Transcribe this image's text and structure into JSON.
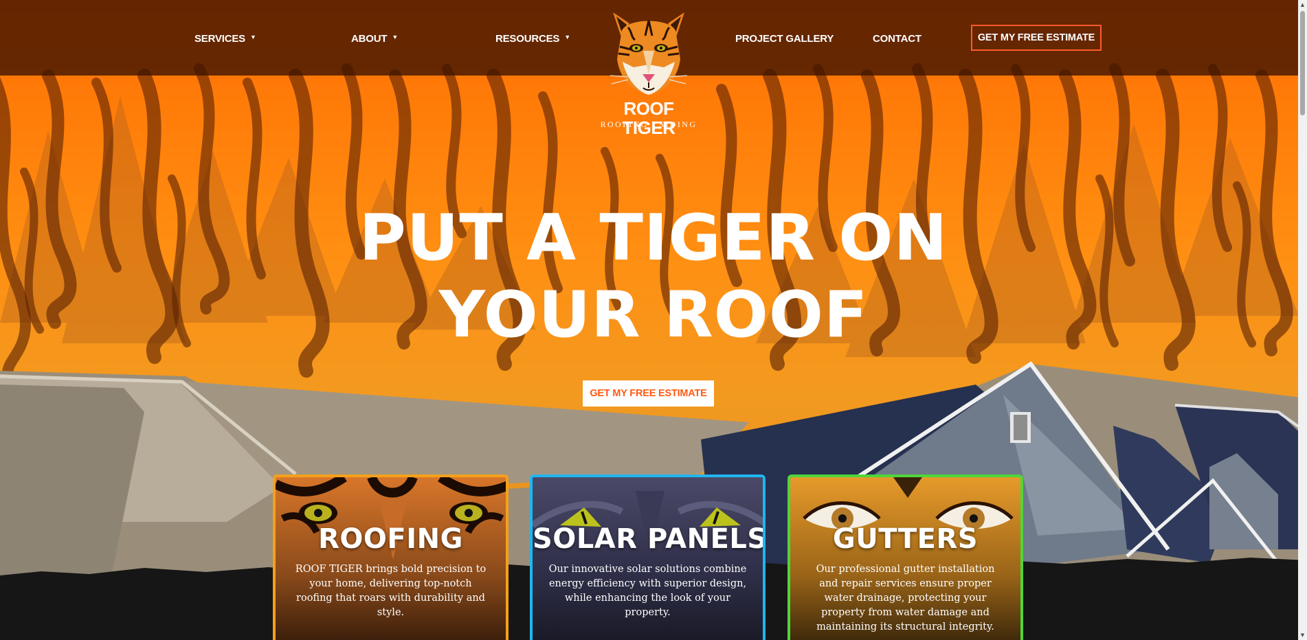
{
  "nav": {
    "items": [
      {
        "label": "SERVICES",
        "has_dropdown": true
      },
      {
        "label": "ABOUT",
        "has_dropdown": true
      },
      {
        "label": "RESOURCES",
        "has_dropdown": true
      },
      {
        "label": "PROJECT GALLERY",
        "has_dropdown": false
      },
      {
        "label": "CONTACT",
        "has_dropdown": false
      }
    ],
    "cta_label": "GET MY FREE ESTIMATE",
    "dropdown_icon": "chevron-down-icon"
  },
  "logo": {
    "wordmark": "ROOF TIGER",
    "tagline": "ROOFING | SIDING",
    "icon": "tiger-head-icon"
  },
  "hero": {
    "headline_line1": "PUT A TIGER ON",
    "headline_line2": "YOUR ROOF",
    "cta_label": "GET MY FREE ESTIMATE"
  },
  "services": [
    {
      "title": "ROOFING",
      "description": "ROOF TIGER brings bold precision to your home, delivering top-notch roofing that roars with durability and style.",
      "border_color": "#f5a01b"
    },
    {
      "title": "SOLAR PANELS",
      "description": "Our innovative solar solutions combine energy efficiency with superior design, while enhancing the look of your property.",
      "border_color": "#1fb6f0"
    },
    {
      "title": "GUTTERS",
      "description": "Our professional gutter installation and repair services ensure proper water drainage, protecting your property from water damage and maintaining its structural integrity.",
      "border_color": "#4fd63a"
    }
  ],
  "colors": {
    "brand_orange": "#ff6a00",
    "accent_red": "#ff5b2e",
    "nav_overlay": "#3e1400",
    "footer_dark": "#161616"
  }
}
